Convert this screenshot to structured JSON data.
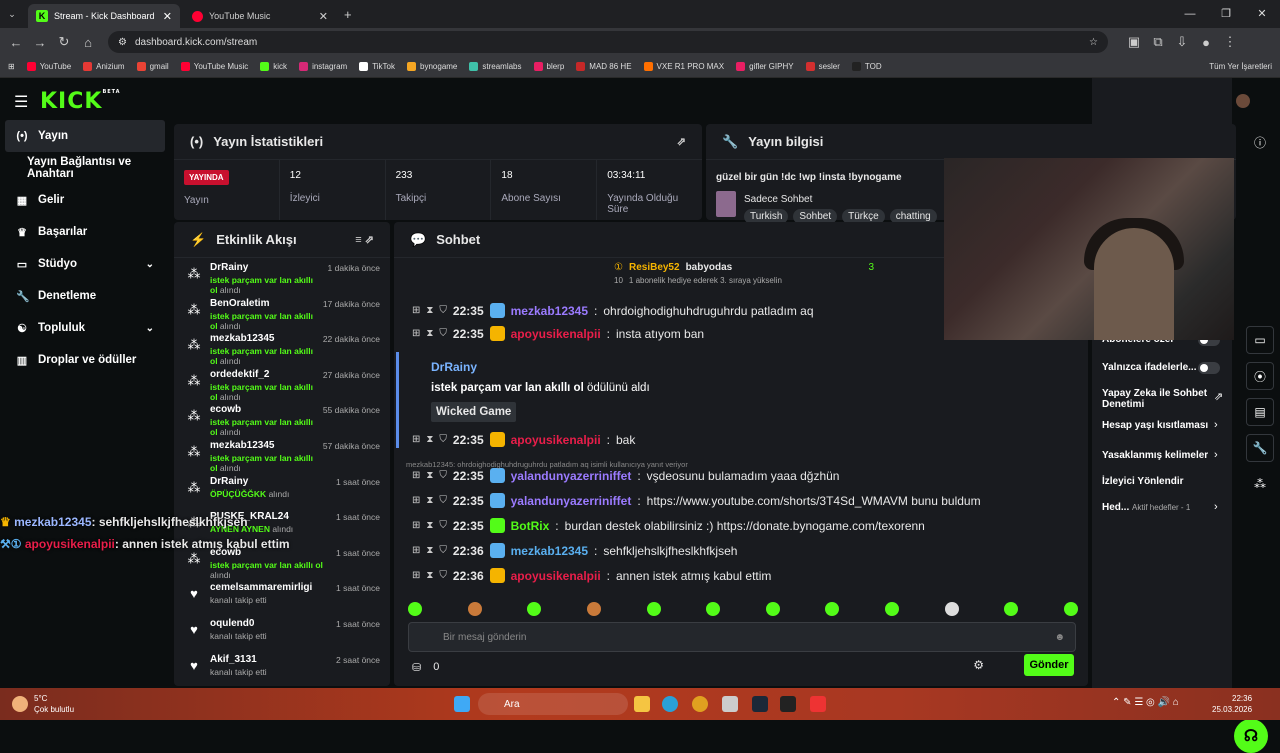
{
  "browser": {
    "tabs": [
      {
        "label": "Stream - Kick Dashboard",
        "active": true
      },
      {
        "label": "YouTube Music",
        "active": false
      }
    ],
    "url": "dashboard.kick.com/stream",
    "bookmarks": [
      "YouTube",
      "Anizium",
      "gmail",
      "YouTube Music",
      "kick",
      "instagram",
      "TikTok",
      "bynogame",
      "streamlabs",
      "blerp",
      "MAD 86 HE",
      "VXE R1 PRO MAX",
      "gifler GIPHY",
      "sesler",
      "TOD"
    ],
    "all_bookmarks": "Tüm Yer İşaretleri"
  },
  "app": {
    "logo": "KICK",
    "logo_sup": "BETA"
  },
  "sidebar": {
    "items": [
      {
        "label": "Yayın",
        "icon": "broadcast-icon"
      },
      {
        "label": "Yayın Bağlantısı ve Anahtarı",
        "icon": ""
      },
      {
        "label": "Gelir",
        "icon": "dollar-icon"
      },
      {
        "label": "Başarılar",
        "icon": "trophy-icon"
      },
      {
        "label": "Stüdyo",
        "icon": "studio-icon"
      },
      {
        "label": "Denetleme",
        "icon": "wrench-icon"
      },
      {
        "label": "Topluluk",
        "icon": "community-icon"
      },
      {
        "label": "Droplar ve ödüller",
        "icon": "drops-icon"
      }
    ]
  },
  "stats": {
    "title": "Yayın İstatistikleri",
    "status_badge": "YAYINDA",
    "status_label": "Yayın",
    "items": [
      {
        "value": "12",
        "label": "İzleyici"
      },
      {
        "value": "233",
        "label": "Takipçi"
      },
      {
        "value": "18",
        "label": "Abone Sayısı"
      },
      {
        "value": "03:34:11",
        "label": "Yayında Olduğu Süre"
      }
    ]
  },
  "stream_info": {
    "title": "Yayın bilgisi",
    "stream_title": "güzel bir gün !dc !wp !insta !bynogame",
    "category": "Sadece Sohbet",
    "tags": [
      "Turkish",
      "Sohbet",
      "Türkçe",
      "chatting"
    ]
  },
  "activity": {
    "title": "Etkinlik Akışı",
    "events": [
      {
        "name": "DrRainy",
        "desc_hl": "istek parçam var lan akıllı ol",
        "desc": " alındı",
        "time": "1 dakika önce"
      },
      {
        "name": "BenOraletim",
        "desc_hl": "istek parçam var lan akıllı ol",
        "desc": " alındı",
        "time": "17 dakika önce"
      },
      {
        "name": "mezkab12345",
        "desc_hl": "istek parçam var lan akıllı ol",
        "desc": " alındı",
        "time": "22 dakika önce"
      },
      {
        "name": "ordedektif_2",
        "desc_hl": "istek parçam var lan akıllı ol",
        "desc": " alındı",
        "time": "27 dakika önce"
      },
      {
        "name": "ecowb",
        "desc_hl": "istek parçam var lan akıllı ol",
        "desc": " alındı",
        "time": "55 dakika önce"
      },
      {
        "name": "mezkab12345",
        "desc_hl": "istek parçam var lan akıllı ol",
        "desc": " alındı",
        "time": "57 dakika önce"
      },
      {
        "name": "DrRainy",
        "desc_hl": "ÖPÜÇÜĞĞKK",
        "desc": " alındı",
        "time": "1 saat önce"
      },
      {
        "name": "PUSKE_KRAL24",
        "desc_hl": "AYNEN AYNEN",
        "desc": " alındı",
        "time": "1 saat önce"
      },
      {
        "name": "ecowb",
        "desc_hl": "istek parçam var lan akıllı ol",
        "desc": " alındı",
        "time": "1 saat önce"
      },
      {
        "name": "cemelsammaremirligi",
        "desc_hl": "",
        "desc": "kanalı takip etti",
        "time": "1 saat önce"
      },
      {
        "name": "oqulend0",
        "desc_hl": "",
        "desc": "kanalı takip etti",
        "time": "1 saat önce"
      },
      {
        "name": "Akif_3131",
        "desc_hl": "",
        "desc": "kanalı takip etti",
        "time": "2 saat önce"
      }
    ]
  },
  "chat": {
    "title": "Sohbet",
    "pinned": {
      "user1": "ResiBey52",
      "count1": "10",
      "user2": "babyodas",
      "count2": "3",
      "gift": "1 abonelik hediye ederek 3. sıraya yükselin"
    },
    "messages": [
      {
        "time": "22:35",
        "user": "mezkab12345",
        "cls": "u-purple",
        "text": "ohrdoighodighuhdruguhrdu patladım aq"
      },
      {
        "time": "22:35",
        "user": "apoyusikenalpii",
        "cls": "u-red",
        "text": "insta atıyom ban"
      },
      {
        "time": "22:35",
        "user": "apoyusikenalpii",
        "cls": "u-red",
        "text": "bak"
      },
      {
        "time": "22:35",
        "user": "yalandunyazerriniffet",
        "cls": "u-purple",
        "text": "vşdeosunu bulamadım yaaa dğzhün"
      },
      {
        "time": "22:35",
        "user": "yalandunyazerriniffet",
        "cls": "u-purple",
        "text": "https://www.youtube.com/shorts/3T4Sd_WMAVM bunu buldum"
      },
      {
        "time": "22:35",
        "user": "BotRix",
        "cls": "u-green",
        "text": "burdan destek olabilirsiniz :) https://donate.bynogame.com/texorenn"
      },
      {
        "time": "22:36",
        "user": "mezkab12345",
        "cls": "u-blue",
        "text": "sehfkljehslkjfheslkhfkjseh"
      },
      {
        "time": "22:36",
        "user": "apoyusikenalpii",
        "cls": "u-red",
        "text": "annen istek atmış kabul ettim"
      }
    ],
    "reward": {
      "user": "DrRainy",
      "text_b": "istek parçam var lan akıllı ol",
      "text": " ödülünü aldı",
      "song": "Wicked Game"
    },
    "reply_ctx": "mezkab12345: ohrdoighodighuhdruguhrdu patladım aq isimli kullanıcıya yanıt veriyor",
    "input_placeholder": "Bir mesaj gönderin",
    "points": "0",
    "send_label": "Gönder"
  },
  "mod_panel": {
    "options": [
      {
        "label": "Abonelere özel",
        "type": "toggle"
      },
      {
        "label": "Yalnızca ifadelerle...",
        "type": "toggle"
      },
      {
        "label": "Yapay Zeka ile Sohbet Denetimi",
        "type": "link"
      },
      {
        "label": "Hesap yaşı kısıtlaması",
        "type": "arrow"
      },
      {
        "label": "Yasaklanmış kelimeler",
        "type": "arrow"
      },
      {
        "label": "İzleyici Yönlendir",
        "type": "none"
      },
      {
        "label": "Hed...",
        "type": "arrow",
        "extra": "Aktif hedefler - 1"
      }
    ]
  },
  "overlay": [
    {
      "user": "mezkab12345",
      "text": ": sehfkljehslkjfheslkhfkjseh"
    },
    {
      "user": "apoyusikenalpii",
      "text": ": annen istek atmış kabul ettim"
    }
  ],
  "taskbar": {
    "temp": "5°C",
    "weather": "Çok bulutlu",
    "search": "Ara",
    "time": "22:36",
    "date": "25.03.2026"
  },
  "colors": {
    "accent": "#53fc18",
    "live": "#c8102e",
    "bg": "#0b0e0f",
    "panel": "#191b1f"
  }
}
